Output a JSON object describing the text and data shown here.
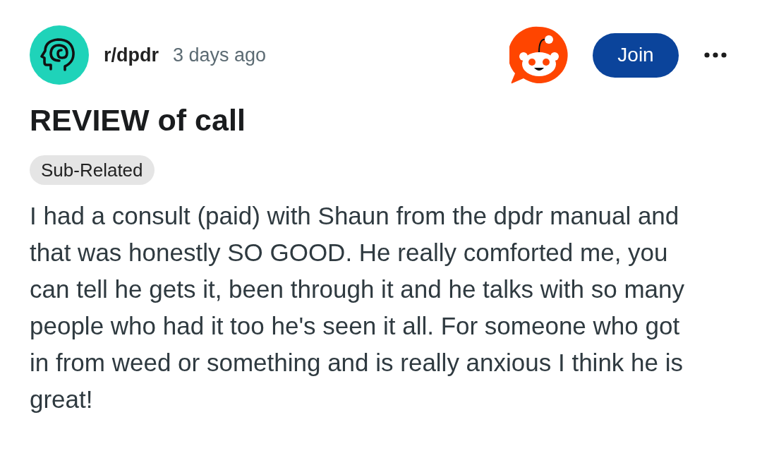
{
  "post": {
    "subreddit": "r/dpdr",
    "time": "3 days ago",
    "join_button": "Join",
    "title": "REVIEW of call",
    "flair": "Sub-Related",
    "body": "I had a consult (paid) with Shaun from the dpdr manual and that was honestly SO GOOD. He really comforted me, you can tell he gets it, been through it and he talks with so many people who had it too he's seen it all. For someone who got in from weed or something and is really anxious I think he is great!"
  }
}
